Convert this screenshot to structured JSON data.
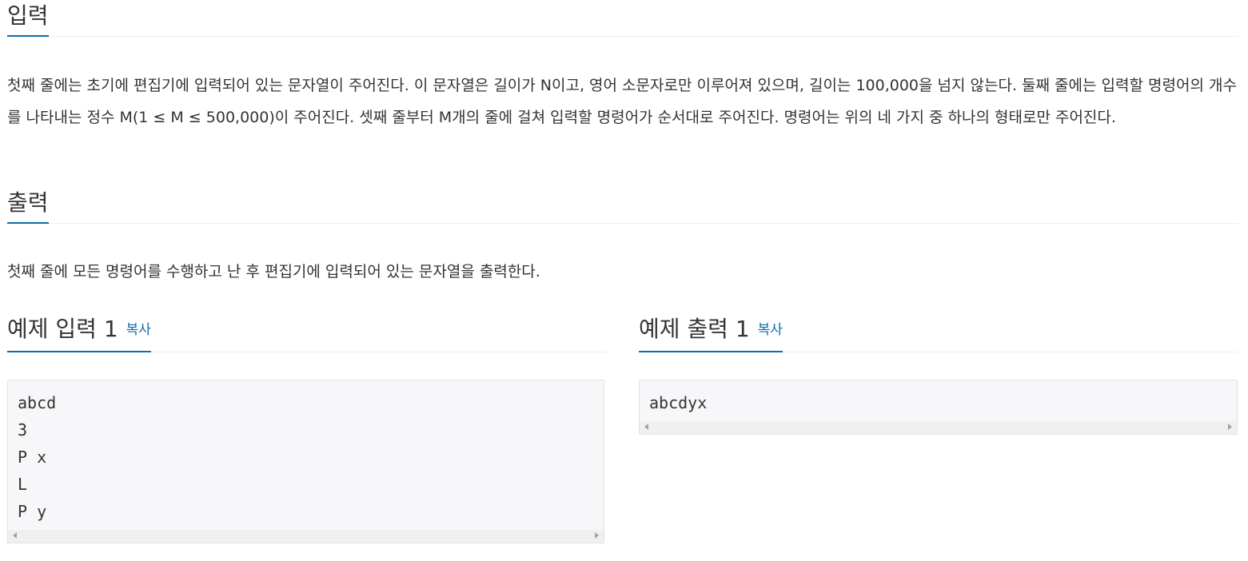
{
  "input_section": {
    "title": "입력",
    "description": "첫째 줄에는 초기에 편집기에 입력되어 있는 문자열이 주어진다. 이 문자열은 길이가 N이고, 영어 소문자로만 이루어져 있으며, 길이는 100,000을 넘지 않는다. 둘째 줄에는 입력할 명령어의 개수를 나타내는 정수 M(1 ≤ M ≤ 500,000)이 주어진다. 셋째 줄부터 M개의 줄에 걸쳐 입력할 명령어가 순서대로 주어진다. 명령어는 위의 네 가지 중 하나의 형태로만 주어진다."
  },
  "output_section": {
    "title": "출력",
    "description": "첫째 줄에 모든 명령어를 수행하고 난 후 편집기에 입력되어 있는 문자열을 출력한다."
  },
  "sample_input": {
    "title": "예제 입력 1",
    "copy_label": "복사",
    "lines": [
      "abcd",
      "3",
      "P x",
      "L",
      "P y"
    ]
  },
  "sample_output": {
    "title": "예제 출력 1",
    "copy_label": "복사",
    "lines": [
      "abcdyx"
    ]
  }
}
